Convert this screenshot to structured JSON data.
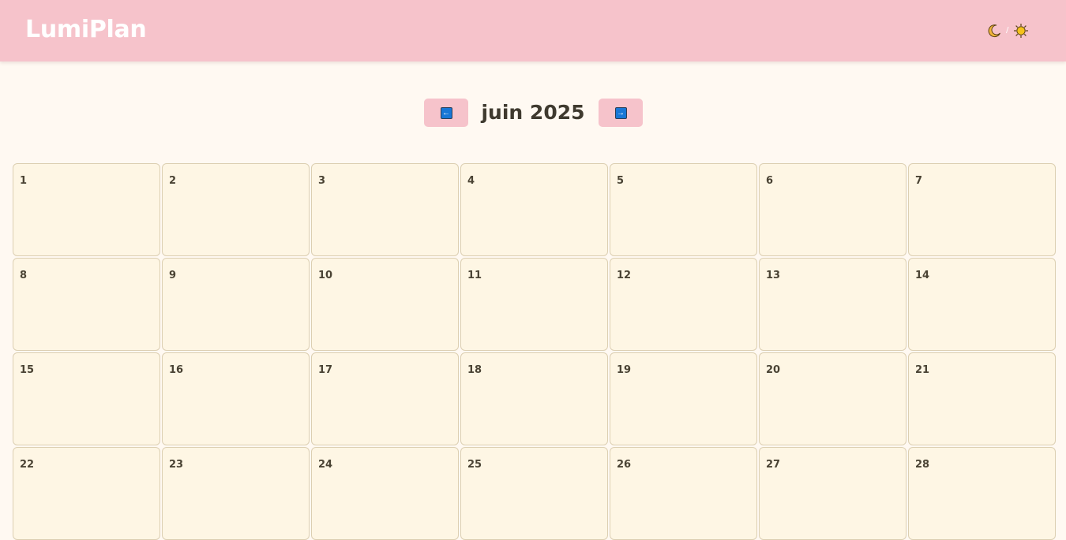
{
  "header": {
    "logo": "LumiPlan",
    "theme_icons": [
      "crescent-moon-icon",
      "sun-icon"
    ]
  },
  "month_nav": {
    "prev_icon": "left-arrow-icon",
    "prev_glyph": "←",
    "title": "juin 2025",
    "next_icon": "right-arrow-icon",
    "next_glyph": "→"
  },
  "calendar": {
    "days": [
      "1",
      "2",
      "3",
      "4",
      "5",
      "6",
      "7",
      "8",
      "9",
      "10",
      "11",
      "12",
      "13",
      "14",
      "15",
      "16",
      "17",
      "18",
      "19",
      "20",
      "21",
      "22",
      "23",
      "24",
      "25",
      "26",
      "27",
      "28"
    ]
  },
  "colors": {
    "header_bg": "#f6c3cb",
    "page_bg": "#fff9f2",
    "cell_bg": "#fef6e4",
    "cell_border": "#dccfb2",
    "arrow_key": "#1877d6"
  }
}
